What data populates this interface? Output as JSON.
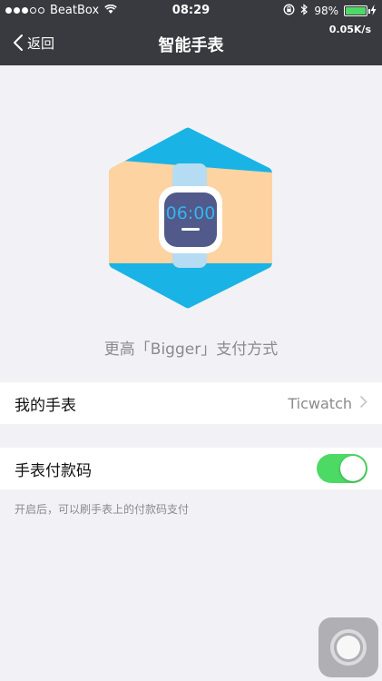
{
  "status_bar": {
    "carrier": "BeatBox",
    "signal_bars_filled": 3,
    "signal_bars_total": 5,
    "time": "08:29",
    "battery_percent": "98%",
    "battery_level": 0.98,
    "network_speed": "0.05K/s"
  },
  "nav": {
    "back_label": "返回",
    "title": "智能手表"
  },
  "hero": {
    "watch_time": "06:00",
    "caption": "更高「Bigger」支付方式",
    "colors": {
      "hexagon": "#1ab3e6",
      "wrist": "#fcd3a1",
      "strap": "#b5dcf2",
      "face": "#515a8a",
      "digits": "#33b5f0"
    }
  },
  "cells": {
    "my_watch": {
      "label": "我的手表",
      "value": "Ticwatch"
    },
    "pay_code": {
      "label": "手表付款码",
      "enabled": true
    }
  },
  "hint": "开启后，可以刷手表上的付款码支付",
  "icons": [
    "signal-dots-icon",
    "wifi-icon",
    "rotation-lock-icon",
    "bluetooth-icon",
    "battery-icon",
    "charging-icon",
    "back-chevron-icon",
    "chevron-right-icon",
    "assistive-touch-icon"
  ],
  "accent": "#4cd964"
}
